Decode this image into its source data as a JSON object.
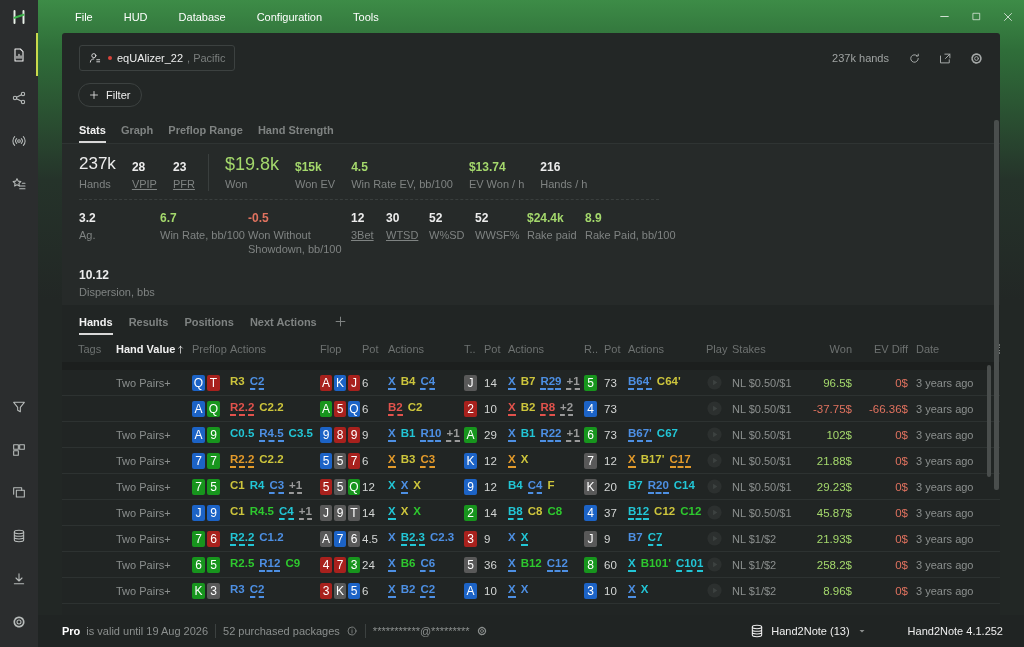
{
  "menu": [
    "File",
    "HUD",
    "Database",
    "Configuration",
    "Tools"
  ],
  "sidebar": {
    "top_items": [
      {
        "selected": true
      },
      {
        "selected": false
      },
      {
        "selected": false
      },
      {
        "selected": false
      }
    ],
    "bottom_items": [
      {
        "selected": false
      },
      {
        "selected": false
      },
      {
        "selected": false
      },
      {
        "selected": false
      },
      {
        "selected": false
      },
      {
        "selected": false
      }
    ]
  },
  "player": {
    "name": "eqUAlizer_22",
    "site": ", Pacific"
  },
  "hands_count": "237k hands",
  "filter_button": "Filter",
  "view_tabs": [
    {
      "label": "Stats",
      "selected": true
    },
    {
      "label": "Graph",
      "selected": false
    },
    {
      "label": "Preflop Range",
      "selected": false
    },
    {
      "label": "Hand Strength",
      "selected": false
    }
  ],
  "stats": {
    "summary": [
      {
        "kind": "big",
        "value": "237k",
        "label": "Hands",
        "color": "#ececec",
        "underlined": false
      },
      {
        "kind": "small",
        "value": "28",
        "label": "VPIP",
        "color": "#ececec",
        "underlined": true
      },
      {
        "kind": "small",
        "value": "23",
        "label": "PFR",
        "color": "#ececec",
        "underlined": true
      },
      {
        "kind": "big",
        "value": "$19.8k",
        "label": "Won",
        "color": "#a4d86c",
        "underlined": false
      },
      {
        "kind": "small",
        "value": "$15k",
        "label": "Won EV",
        "color": "#a4d86c",
        "underlined": false
      },
      {
        "kind": "small",
        "value": "4.5",
        "label": "Win Rate EV, bb/100",
        "color": "#a4d86c",
        "underlined": false
      },
      {
        "kind": "small",
        "value": "$13.74",
        "label": "EV Won / h",
        "color": "#a4d86c",
        "underlined": false
      },
      {
        "kind": "small",
        "value": "216",
        "label": "Hands / h",
        "color": "#ececec",
        "underlined": false
      }
    ],
    "details": [
      {
        "value": "3.2",
        "label": "Ag.",
        "color": "#ececec",
        "underlined": false
      },
      {
        "value": "6.7",
        "label": "Win Rate, bb/100",
        "color": "#a4d86c",
        "underlined": false
      },
      {
        "value": "-0.5",
        "label": "Won Without Showdown, bb/100",
        "color": "#e0725f",
        "underlined": false
      },
      {
        "value": "12",
        "label": "3Bet",
        "color": "#ececec",
        "underlined": true
      },
      {
        "value": "30",
        "label": "WTSD",
        "color": "#ececec",
        "underlined": true
      },
      {
        "value": "52",
        "label": "W%SD",
        "color": "#ececec",
        "underlined": false
      },
      {
        "value": "52",
        "label": "WWSF%",
        "color": "#ececec",
        "underlined": false
      },
      {
        "value": "$24.4k",
        "label": "Rake paid",
        "color": "#a4d86c",
        "underlined": false
      },
      {
        "value": "8.9",
        "label": "Rake Paid, bb/100",
        "color": "#a4d86c",
        "underlined": false
      },
      {
        "value": "10.12",
        "label": "Dispersion, bbs",
        "color": "#ececec",
        "underlined": false
      }
    ]
  },
  "table_tabs": [
    {
      "label": "Hands",
      "selected": true
    },
    {
      "label": "Results",
      "selected": false
    },
    {
      "label": "Positions",
      "selected": false
    },
    {
      "label": "Next Actions",
      "selected": false
    }
  ],
  "table": {
    "columns": [
      {
        "label": "Tags",
        "sorted": false
      },
      {
        "label": "Hand Value",
        "sorted": true
      },
      {
        "label": "Preflop",
        "sorted": false
      },
      {
        "label": "Actions",
        "sorted": false
      },
      {
        "label": "Flop",
        "sorted": false
      },
      {
        "label": "Pot",
        "sorted": false
      },
      {
        "label": "Actions",
        "sorted": false
      },
      {
        "label": "T..",
        "sorted": false
      },
      {
        "label": "Pot",
        "sorted": false
      },
      {
        "label": "Actions",
        "sorted": false
      },
      {
        "label": "R..",
        "sorted": false
      },
      {
        "label": "Pot",
        "sorted": false
      },
      {
        "label": "Actions",
        "sorted": false
      },
      {
        "label": "Play",
        "sorted": false
      },
      {
        "label": "Stakes",
        "sorted": false
      },
      {
        "label": "Won",
        "sorted": false
      },
      {
        "label": "EV Diff",
        "sorted": false
      },
      {
        "label": "Date",
        "sorted": false
      }
    ],
    "rows": [
      {
        "hand_value": "Two Pairs+",
        "preflop": {
          "cards": [
            {
              "rank": "Q",
              "color": "#1c63c6"
            },
            {
              "rank": "T",
              "color": "#a8211d"
            }
          ],
          "actions": [
            {
              "text": "R3",
              "color": "#cdc53c",
              "underlined": false
            },
            {
              "text": "C2",
              "color": "#4d8fe3",
              "underlined": true
            }
          ]
        },
        "flop": {
          "cards": [
            {
              "rank": "A",
              "color": "#a8211d"
            },
            {
              "rank": "K",
              "color": "#1c63c6"
            },
            {
              "rank": "J",
              "color": "#a8211d"
            }
          ],
          "pot": "6",
          "actions": [
            {
              "text": "X",
              "color": "#4d8fe3",
              "underlined": true
            },
            {
              "text": "B4",
              "color": "#cdc53c",
              "underlined": false
            },
            {
              "text": "C4",
              "color": "#4d8fe3",
              "underlined": true
            }
          ]
        },
        "turn": {
          "cards": [
            {
              "rank": "J",
              "color": "#595959"
            }
          ],
          "pot": "14",
          "actions": [
            {
              "text": "X",
              "color": "#4d8fe3",
              "underlined": true
            },
            {
              "text": "B7",
              "color": "#cdc53c",
              "underlined": false
            },
            {
              "text": "R29",
              "color": "#4d8fe3",
              "underlined": true
            },
            {
              "text": "+1",
              "color": "#9a9a9a",
              "underlined": true
            }
          ]
        },
        "river": {
          "cards": [
            {
              "rank": "5",
              "color": "#17951d"
            }
          ],
          "pot": "73",
          "actions": [
            {
              "text": "B64'",
              "color": "#4d8fe3",
              "underlined": true
            },
            {
              "text": "C64'",
              "color": "#cdc53c",
              "underlined": false
            }
          ]
        },
        "stakes": "NL $0.50/$1",
        "won": {
          "text": "96.5$",
          "color": "#a4d86c"
        },
        "ev_diff": {
          "text": "0$",
          "color": "#e0725f"
        },
        "date": "3 years ago"
      },
      {
        "preflop": {
          "cards": [
            {
              "rank": "A",
              "color": "#1c63c6"
            },
            {
              "rank": "Q",
              "color": "#17951d"
            }
          ],
          "actions": [
            {
              "text": "R2.2",
              "color": "#e2524c",
              "underlined": true
            },
            {
              "text": "C2.2",
              "color": "#cdc53c",
              "underlined": false
            }
          ]
        },
        "flop": {
          "cards": [
            {
              "rank": "A",
              "color": "#17951d"
            },
            {
              "rank": "5",
              "color": "#a8211d"
            },
            {
              "rank": "Q",
              "color": "#1c63c6"
            }
          ],
          "pot": "6",
          "actions": [
            {
              "text": "B2",
              "color": "#e2524c",
              "underlined": true
            },
            {
              "text": "C2",
              "color": "#cdc53c",
              "underlined": false
            }
          ]
        },
        "turn": {
          "cards": [
            {
              "rank": "2",
              "color": "#a8211d"
            }
          ],
          "pot": "10",
          "actions": [
            {
              "text": "X",
              "color": "#e2524c",
              "underlined": true
            },
            {
              "text": "B2",
              "color": "#cdc53c",
              "underlined": false
            },
            {
              "text": "R8",
              "color": "#e2524c",
              "underlined": true
            },
            {
              "text": "+2",
              "color": "#9a9a9a",
              "underlined": true
            }
          ]
        },
        "river": {
          "cards": [
            {
              "rank": "4",
              "color": "#1c63c6"
            }
          ],
          "pot": "73"
        },
        "stakes": "NL $0.50/$1",
        "won": {
          "text": "-37.75$",
          "color": "#e0725f"
        },
        "ev_diff": {
          "text": "-66.36$",
          "color": "#e0725f"
        },
        "date": "3 years ago"
      },
      {
        "hand_value": "Two Pairs+",
        "preflop": {
          "cards": [
            {
              "rank": "A",
              "color": "#1c63c6"
            },
            {
              "rank": "9",
              "color": "#17951d"
            }
          ],
          "actions": [
            {
              "text": "C0.5",
              "color": "#22c6d6",
              "underlined": false
            },
            {
              "text": "R4.5",
              "color": "#4d8fe3",
              "underlined": true
            },
            {
              "text": "C3.5",
              "color": "#22c6d6",
              "underlined": false
            }
          ]
        },
        "flop": {
          "cards": [
            {
              "rank": "9",
              "color": "#1c63c6"
            },
            {
              "rank": "8",
              "color": "#a8211d"
            },
            {
              "rank": "9",
              "color": "#a8211d"
            }
          ],
          "pot": "9",
          "actions": [
            {
              "text": "X",
              "color": "#4d8fe3",
              "underlined": true
            },
            {
              "text": "B1",
              "color": "#22c6d6",
              "underlined": false
            },
            {
              "text": "R10",
              "color": "#4d8fe3",
              "underlined": true
            },
            {
              "text": "+1",
              "color": "#9a9a9a",
              "underlined": true
            }
          ]
        },
        "turn": {
          "cards": [
            {
              "rank": "A",
              "color": "#17951d"
            }
          ],
          "pot": "29",
          "actions": [
            {
              "text": "X",
              "color": "#4d8fe3",
              "underlined": true
            },
            {
              "text": "B1",
              "color": "#22c6d6",
              "underlined": false
            },
            {
              "text": "R22",
              "color": "#4d8fe3",
              "underlined": true
            },
            {
              "text": "+1",
              "color": "#9a9a9a",
              "underlined": true
            }
          ]
        },
        "river": {
          "cards": [
            {
              "rank": "6",
              "color": "#17951d"
            }
          ],
          "pot": "73",
          "actions": [
            {
              "text": "B67'",
              "color": "#4d8fe3",
              "underlined": true
            },
            {
              "text": "C67",
              "color": "#22c6d6",
              "underlined": false
            }
          ]
        },
        "stakes": "NL $0.50/$1",
        "won": {
          "text": "102$",
          "color": "#a4d86c"
        },
        "ev_diff": {
          "text": "0$",
          "color": "#e0725f"
        },
        "date": "3 years ago"
      },
      {
        "hand_value": "Two Pairs+",
        "preflop": {
          "cards": [
            {
              "rank": "7",
              "color": "#1c63c6"
            },
            {
              "rank": "7",
              "color": "#17951d"
            }
          ],
          "actions": [
            {
              "text": "R2.2",
              "color": "#e39a2b",
              "underlined": true
            },
            {
              "text": "C2.2",
              "color": "#cdc53c",
              "underlined": false
            }
          ]
        },
        "flop": {
          "cards": [
            {
              "rank": "5",
              "color": "#1c63c6"
            },
            {
              "rank": "5",
              "color": "#595959"
            },
            {
              "rank": "7",
              "color": "#a8211d"
            }
          ],
          "pot": "6",
          "actions": [
            {
              "text": "X",
              "color": "#e39a2b",
              "underlined": true
            },
            {
              "text": "B3",
              "color": "#cdc53c",
              "underlined": false
            },
            {
              "text": "C3",
              "color": "#e39a2b",
              "underlined": true
            }
          ]
        },
        "turn": {
          "cards": [
            {
              "rank": "K",
              "color": "#1c63c6"
            }
          ],
          "pot": "12",
          "actions": [
            {
              "text": "X",
              "color": "#e39a2b",
              "underlined": true
            },
            {
              "text": "X",
              "color": "#cdc53c",
              "underlined": false
            }
          ]
        },
        "river": {
          "cards": [
            {
              "rank": "7",
              "color": "#595959"
            }
          ],
          "pot": "12",
          "actions": [
            {
              "text": "X",
              "color": "#e39a2b",
              "underlined": true
            },
            {
              "text": "B17'",
              "color": "#cdc53c",
              "underlined": false
            },
            {
              "text": "C17",
              "color": "#e39a2b",
              "underlined": true
            }
          ]
        },
        "stakes": "NL $0.50/$1",
        "won": {
          "text": "21.88$",
          "color": "#a4d86c"
        },
        "ev_diff": {
          "text": "0$",
          "color": "#e0725f"
        },
        "date": "3 years ago"
      },
      {
        "hand_value": "Two Pairs+",
        "preflop": {
          "cards": [
            {
              "rank": "7",
              "color": "#17951d"
            },
            {
              "rank": "5",
              "color": "#17951d"
            }
          ],
          "actions": [
            {
              "text": "C1",
              "color": "#cdc53c",
              "underlined": false
            },
            {
              "text": "R4",
              "color": "#22c6d6",
              "underlined": false
            },
            {
              "text": "C3",
              "color": "#4d8fe3",
              "underlined": true
            },
            {
              "text": "+1",
              "color": "#9a9a9a",
              "underlined": true
            }
          ]
        },
        "flop": {
          "cards": [
            {
              "rank": "5",
              "color": "#a8211d"
            },
            {
              "rank": "5",
              "color": "#595959"
            },
            {
              "rank": "Q",
              "color": "#17951d"
            }
          ],
          "pot": "12",
          "actions": [
            {
              "text": "X",
              "color": "#22c6d6",
              "underlined": false
            },
            {
              "text": "X",
              "color": "#4d8fe3",
              "underlined": true
            },
            {
              "text": "X",
              "color": "#cdc53c",
              "underlined": false
            }
          ]
        },
        "turn": {
          "cards": [
            {
              "rank": "9",
              "color": "#1c63c6"
            }
          ],
          "pot": "12",
          "actions": [
            {
              "text": "B4",
              "color": "#22c6d6",
              "underlined": false
            },
            {
              "text": "C4",
              "color": "#4d8fe3",
              "underlined": true
            },
            {
              "text": "F",
              "color": "#cdc53c",
              "underlined": false
            }
          ]
        },
        "river": {
          "cards": [
            {
              "rank": "K",
              "color": "#595959"
            }
          ],
          "pot": "20",
          "actions": [
            {
              "text": "B7",
              "color": "#22c6d6",
              "underlined": false
            },
            {
              "text": "R20",
              "color": "#4d8fe3",
              "underlined": true
            },
            {
              "text": "C14",
              "color": "#22c6d6",
              "underlined": false
            }
          ]
        },
        "stakes": "NL $0.50/$1",
        "won": {
          "text": "29.23$",
          "color": "#a4d86c"
        },
        "ev_diff": {
          "text": "0$",
          "color": "#e0725f"
        },
        "date": "3 years ago"
      },
      {
        "hand_value": "Two Pairs+",
        "preflop": {
          "cards": [
            {
              "rank": "J",
              "color": "#1c63c6"
            },
            {
              "rank": "9",
              "color": "#1c63c6"
            }
          ],
          "actions": [
            {
              "text": "C1",
              "color": "#cdc53c",
              "underlined": false
            },
            {
              "text": "R4.5",
              "color": "#2ec82e",
              "underlined": false
            },
            {
              "text": "C4",
              "color": "#22c6d6",
              "underlined": true
            },
            {
              "text": "+1",
              "color": "#9a9a9a",
              "underlined": true
            }
          ]
        },
        "flop": {
          "cards": [
            {
              "rank": "J",
              "color": "#595959"
            },
            {
              "rank": "9",
              "color": "#595959"
            },
            {
              "rank": "T",
              "color": "#595959"
            }
          ],
          "pot": "14",
          "actions": [
            {
              "text": "X",
              "color": "#22c6d6",
              "underlined": true
            },
            {
              "text": "X",
              "color": "#cdc53c",
              "underlined": false
            },
            {
              "text": "X",
              "color": "#2ec82e",
              "underlined": false
            }
          ]
        },
        "turn": {
          "cards": [
            {
              "rank": "2",
              "color": "#17951d"
            }
          ],
          "pot": "14",
          "actions": [
            {
              "text": "B8",
              "color": "#22c6d6",
              "underlined": true
            },
            {
              "text": "C8",
              "color": "#cdc53c",
              "underlined": false
            },
            {
              "text": "C8",
              "color": "#2ec82e",
              "underlined": false
            }
          ]
        },
        "river": {
          "cards": [
            {
              "rank": "4",
              "color": "#1c63c6"
            }
          ],
          "pot": "37",
          "actions": [
            {
              "text": "B12",
              "color": "#22c6d6",
              "underlined": true
            },
            {
              "text": "C12",
              "color": "#cdc53c",
              "underlined": false
            },
            {
              "text": "C12",
              "color": "#2ec82e",
              "underlined": false
            }
          ]
        },
        "stakes": "NL $0.50/$1",
        "won": {
          "text": "45.87$",
          "color": "#a4d86c"
        },
        "ev_diff": {
          "text": "0$",
          "color": "#e0725f"
        },
        "date": "3 years ago"
      },
      {
        "hand_value": "Two Pairs+",
        "preflop": {
          "cards": [
            {
              "rank": "7",
              "color": "#17951d"
            },
            {
              "rank": "6",
              "color": "#a8211d"
            }
          ],
          "actions": [
            {
              "text": "R2.2",
              "color": "#22c6d6",
              "underlined": true
            },
            {
              "text": "C1.2",
              "color": "#4d8fe3",
              "underlined": false
            }
          ]
        },
        "flop": {
          "cards": [
            {
              "rank": "A",
              "color": "#595959"
            },
            {
              "rank": "7",
              "color": "#1c63c6"
            },
            {
              "rank": "6",
              "color": "#595959"
            }
          ],
          "pot": "4.5",
          "actions": [
            {
              "text": "X",
              "color": "#4d8fe3",
              "underlined": false
            },
            {
              "text": "B2.3",
              "color": "#22c6d6",
              "underlined": true
            },
            {
              "text": "C2.3",
              "color": "#4d8fe3",
              "underlined": false
            }
          ]
        },
        "turn": {
          "cards": [
            {
              "rank": "3",
              "color": "#a8211d"
            }
          ],
          "pot": "9",
          "actions": [
            {
              "text": "X",
              "color": "#4d8fe3",
              "underlined": false
            },
            {
              "text": "X",
              "color": "#22c6d6",
              "underlined": true
            }
          ]
        },
        "river": {
          "cards": [
            {
              "rank": "J",
              "color": "#595959"
            }
          ],
          "pot": "9",
          "actions": [
            {
              "text": "B7",
              "color": "#4d8fe3",
              "underlined": false
            },
            {
              "text": "C7",
              "color": "#22c6d6",
              "underlined": true
            }
          ]
        },
        "stakes": "NL $1/$2",
        "won": {
          "text": "21.93$",
          "color": "#a4d86c"
        },
        "ev_diff": {
          "text": "0$",
          "color": "#e0725f"
        },
        "date": "3 years ago"
      },
      {
        "hand_value": "Two Pairs+",
        "preflop": {
          "cards": [
            {
              "rank": "6",
              "color": "#17951d"
            },
            {
              "rank": "5",
              "color": "#17951d"
            }
          ],
          "actions": [
            {
              "text": "R2.5",
              "color": "#2ec82e",
              "underlined": false
            },
            {
              "text": "R12",
              "color": "#4d8fe3",
              "underlined": true
            },
            {
              "text": "C9",
              "color": "#2ec82e",
              "underlined": false
            }
          ]
        },
        "flop": {
          "cards": [
            {
              "rank": "4",
              "color": "#a8211d"
            },
            {
              "rank": "7",
              "color": "#a8211d"
            },
            {
              "rank": "3",
              "color": "#17951d"
            }
          ],
          "pot": "24",
          "actions": [
            {
              "text": "X",
              "color": "#4d8fe3",
              "underlined": true
            },
            {
              "text": "B6",
              "color": "#2ec82e",
              "underlined": false
            },
            {
              "text": "C6",
              "color": "#4d8fe3",
              "underlined": true
            }
          ]
        },
        "turn": {
          "cards": [
            {
              "rank": "5",
              "color": "#595959"
            }
          ],
          "pot": "36",
          "actions": [
            {
              "text": "X",
              "color": "#4d8fe3",
              "underlined": true
            },
            {
              "text": "B12",
              "color": "#2ec82e",
              "underlined": false
            },
            {
              "text": "C12",
              "color": "#4d8fe3",
              "underlined": true
            }
          ]
        },
        "river": {
          "cards": [
            {
              "rank": "8",
              "color": "#17951d"
            }
          ],
          "pot": "60",
          "actions": [
            {
              "text": "X",
              "color": "#22c6d6",
              "underlined": true
            },
            {
              "text": "B101'",
              "color": "#2ec82e",
              "underlined": false
            },
            {
              "text": "C101",
              "color": "#22c6d6",
              "underlined": true
            }
          ]
        },
        "stakes": "NL $1/$2",
        "won": {
          "text": "258.2$",
          "color": "#a4d86c"
        },
        "ev_diff": {
          "text": "0$",
          "color": "#e0725f"
        },
        "date": "3 years ago"
      },
      {
        "hand_value": "Two Pairs+",
        "preflop": {
          "cards": [
            {
              "rank": "K",
              "color": "#17951d"
            },
            {
              "rank": "3",
              "color": "#595959"
            }
          ],
          "actions": [
            {
              "text": "R3",
              "color": "#4d8fe3",
              "underlined": false
            },
            {
              "text": "C2",
              "color": "#4d8fe3",
              "underlined": true
            }
          ]
        },
        "flop": {
          "cards": [
            {
              "rank": "3",
              "color": "#a8211d"
            },
            {
              "rank": "K",
              "color": "#595959"
            },
            {
              "rank": "5",
              "color": "#1c63c6"
            }
          ],
          "pot": "6",
          "actions": [
            {
              "text": "X",
              "color": "#4d8fe3",
              "underlined": true
            },
            {
              "text": "B2",
              "color": "#4d8fe3",
              "underlined": false
            },
            {
              "text": "C2",
              "color": "#4d8fe3",
              "underlined": true
            }
          ]
        },
        "turn": {
          "cards": [
            {
              "rank": "A",
              "color": "#1c63c6"
            }
          ],
          "pot": "10",
          "actions": [
            {
              "text": "X",
              "color": "#4d8fe3",
              "underlined": true
            },
            {
              "text": "X",
              "color": "#4d8fe3",
              "underlined": false
            }
          ]
        },
        "river": {
          "cards": [
            {
              "rank": "3",
              "color": "#1c63c6"
            }
          ],
          "pot": "10",
          "actions": [
            {
              "text": "X",
              "color": "#4d8fe3",
              "underlined": true
            },
            {
              "text": "X",
              "color": "#22c6d6",
              "underlined": false
            }
          ]
        },
        "stakes": "NL $1/$2",
        "won": {
          "text": "8.96$",
          "color": "#a4d86c"
        },
        "ev_diff": {
          "text": "0$",
          "color": "#e0725f"
        },
        "date": "3 years ago"
      }
    ]
  },
  "status_bar": {
    "license": "Pro",
    "validity": "is valid until 19 Aug 2026",
    "packages": "52 purchased packages",
    "account": "***********@*********",
    "database": "Hand2Note (13)",
    "version": "Hand2Note 4.1.252"
  }
}
